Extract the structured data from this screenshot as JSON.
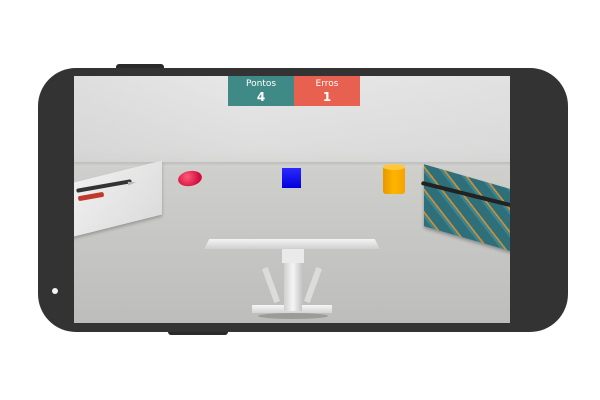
{
  "hud": {
    "points_label": "Pontos",
    "points_value": "4",
    "errors_label": "Erros",
    "errors_value": "1"
  },
  "colors": {
    "points_bg": "#3f8a86",
    "errors_bg": "#e8604f",
    "target_red": "#d10d3e",
    "target_blue": "#0000dd",
    "target_yellow": "#ffb400"
  }
}
